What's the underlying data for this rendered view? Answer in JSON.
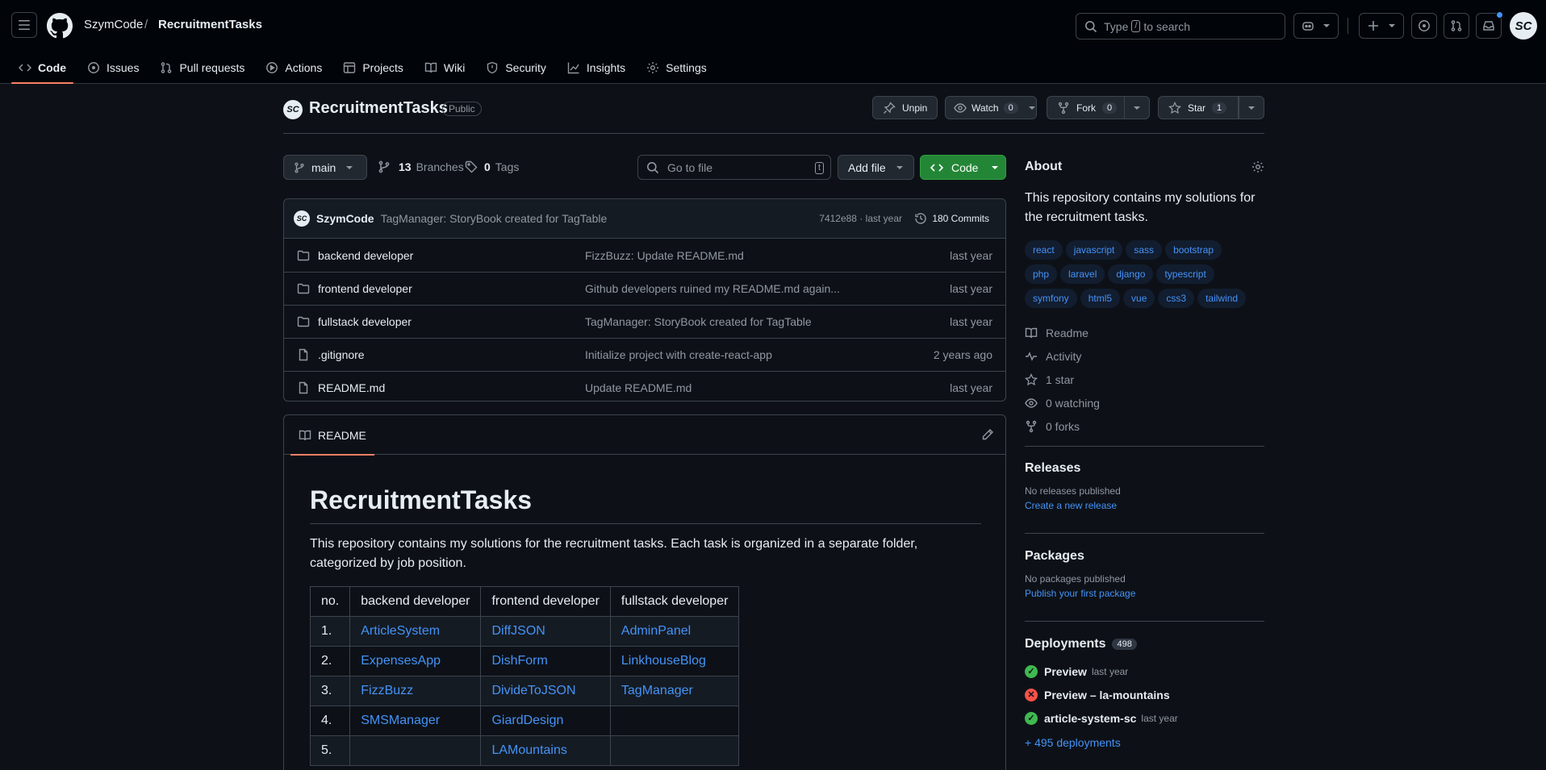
{
  "header": {
    "owner": "SzymCode",
    "separator": "/",
    "repo": "RecruitmentTasks",
    "search_prefix": "Type",
    "search_key": "/",
    "search_suffix": "to search",
    "avatar_initials": "SC"
  },
  "nav_tabs": [
    "Code",
    "Issues",
    "Pull requests",
    "Actions",
    "Projects",
    "Wiki",
    "Security",
    "Insights",
    "Settings"
  ],
  "repo_header": {
    "title": "RecruitmentTasks",
    "visibility": "Public",
    "unpin": "Unpin",
    "watch": "Watch",
    "watch_count": "0",
    "fork": "Fork",
    "fork_count": "0",
    "star": "Star",
    "star_count": "1"
  },
  "toolbar": {
    "branch": "main",
    "branches_count": "13",
    "branches_label": "Branches",
    "tags_count": "0",
    "tags_label": "Tags",
    "goto_placeholder": "Go to file",
    "goto_key": "t",
    "add_file": "Add file",
    "code": "Code"
  },
  "commit": {
    "author": "SzymCode",
    "message": "TagManager: StoryBook created for TagTable",
    "hash_time": "7412e88 · last year",
    "commits": "180 Commits"
  },
  "files": [
    {
      "name": "backend developer",
      "type": "folder",
      "message": "FizzBuzz: Update README.md",
      "time": "last year"
    },
    {
      "name": "frontend developer",
      "type": "folder",
      "message": "Github developers ruined my README.md again...",
      "time": "last year"
    },
    {
      "name": "fullstack developer",
      "type": "folder",
      "message": "TagManager: StoryBook created for TagTable",
      "time": "last year"
    },
    {
      "name": ".gitignore",
      "type": "file",
      "message": "Initialize project with create-react-app",
      "time": "2 years ago"
    },
    {
      "name": "README.md",
      "type": "file",
      "message": "Update README.md",
      "time": "last year"
    }
  ],
  "readme": {
    "tab": "README",
    "title": "RecruitmentTasks",
    "description": "This repository contains my solutions for the recruitment tasks. Each task is organized in a separate folder, categorized by job position.",
    "table_headers": [
      "no.",
      "backend developer",
      "frontend developer",
      "fullstack developer"
    ],
    "table_rows": [
      [
        "1.",
        "ArticleSystem",
        "DiffJSON",
        "AdminPanel"
      ],
      [
        "2.",
        "ExpensesApp",
        "DishForm",
        "LinkhouseBlog"
      ],
      [
        "3.",
        "FizzBuzz",
        "DivideToJSON",
        "TagManager"
      ],
      [
        "4.",
        "SMSManager",
        "GiardDesign",
        ""
      ],
      [
        "5.",
        "",
        "LAMountains",
        ""
      ]
    ]
  },
  "about": {
    "title": "About",
    "description": "This repository contains my solutions for the recruitment tasks.",
    "topics": [
      "react",
      "javascript",
      "sass",
      "bootstrap",
      "php",
      "laravel",
      "django",
      "typescript",
      "symfony",
      "html5",
      "vue",
      "css3",
      "tailwind"
    ],
    "links": [
      {
        "icon": "book-icon",
        "label": "Readme"
      },
      {
        "icon": "pulse-icon",
        "label": "Activity"
      },
      {
        "icon": "star-icon",
        "label": "1 star"
      },
      {
        "icon": "eye-icon",
        "label": "0 watching"
      },
      {
        "icon": "fork-icon",
        "label": "0 forks"
      }
    ]
  },
  "releases": {
    "title": "Releases",
    "none": "No releases published",
    "link": "Create a new release"
  },
  "packages": {
    "title": "Packages",
    "none": "No packages published",
    "link": "Publish your first package"
  },
  "deployments": {
    "title": "Deployments",
    "count": "498",
    "items": [
      {
        "name": "Preview",
        "time": "last year",
        "status": "success"
      },
      {
        "name": "Preview – la-mountains",
        "time": "",
        "status": "failure"
      },
      {
        "name": "article-system-sc",
        "time": "last year",
        "status": "success"
      }
    ],
    "more": "+ 495 deployments"
  },
  "colors": {
    "success": "#3fb950",
    "failure": "#f85149",
    "accent": "#4493f8",
    "code_button": "#238636",
    "active_tab": "#f78166"
  }
}
